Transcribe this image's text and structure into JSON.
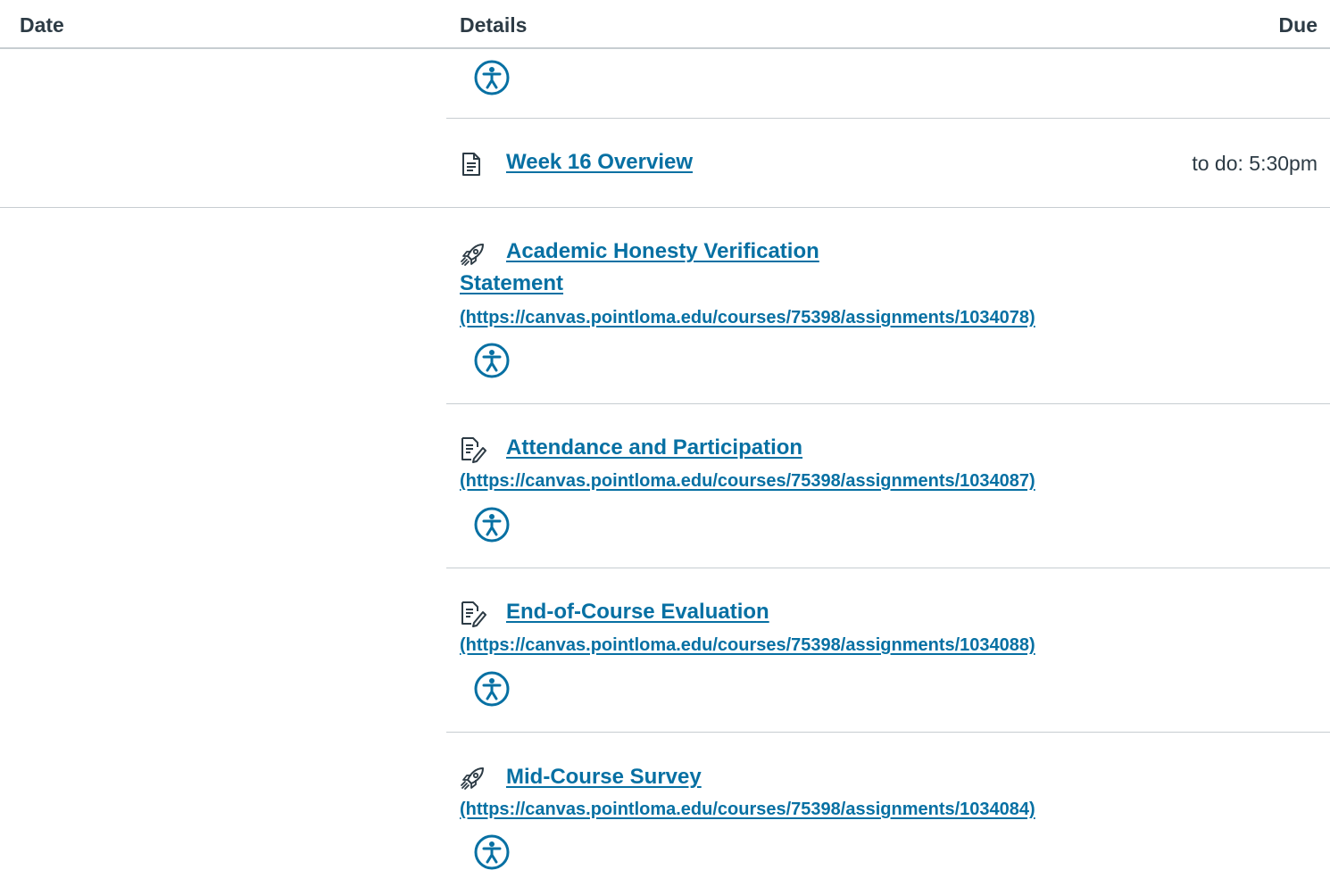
{
  "table": {
    "headers": {
      "date": "Date",
      "details": "Details",
      "due": "Due"
    }
  },
  "rows": [
    {
      "icon": "accessibility-icon"
    },
    {
      "icon": "page-icon",
      "title": "Week 16 Overview",
      "due": "to do: 5:30pm"
    },
    {
      "icon": "quiz-rocket-icon",
      "title_line1": "Academic Honesty Verification",
      "title_line2": "Statement",
      "url": "(https://canvas.pointloma.edu/courses/75398/assignments/1034078)",
      "accessibility_icon": "accessibility-icon"
    },
    {
      "icon": "assignment-icon",
      "title": "Attendance and Participation",
      "url": "(https://canvas.pointloma.edu/courses/75398/assignments/1034087)",
      "accessibility_icon": "accessibility-icon"
    },
    {
      "icon": "assignment-icon",
      "title": "End-of-Course Evaluation",
      "url": "(https://canvas.pointloma.edu/courses/75398/assignments/1034088)",
      "accessibility_icon": "accessibility-icon"
    },
    {
      "icon": "quiz-rocket-icon",
      "title": "Mid-Course Survey",
      "url": "(https://canvas.pointloma.edu/courses/75398/assignments/1034084)",
      "accessibility_icon": "accessibility-icon"
    }
  ],
  "colors": {
    "link": "#0770a3",
    "text": "#2d3b45",
    "divider": "#c7cdd1",
    "accessibility": "#0770a3"
  }
}
